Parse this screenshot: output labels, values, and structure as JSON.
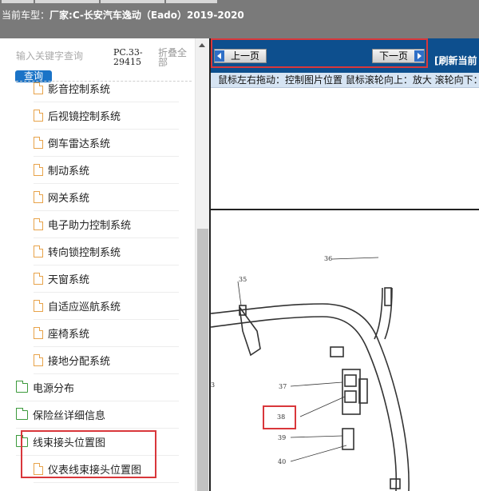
{
  "header": {
    "car_label": "当前车型：",
    "car_name": "厂家:C-长安汽车逸动（Eado）2019-2020"
  },
  "search": {
    "placeholder": "输入关键字查询",
    "button": "查询",
    "pc_code": "PC.33-29415",
    "collapse_all": "折叠全部"
  },
  "tree": [
    {
      "label": "影音控制系统",
      "icon": "file-icon",
      "level": 2
    },
    {
      "label": "后视镜控制系统",
      "icon": "file-icon",
      "level": 2
    },
    {
      "label": "倒车雷达系统",
      "icon": "file-icon",
      "level": 2
    },
    {
      "label": "制动系统",
      "icon": "file-icon",
      "level": 2
    },
    {
      "label": "网关系统",
      "icon": "file-icon",
      "level": 2
    },
    {
      "label": "电子助力控制系统",
      "icon": "file-icon",
      "level": 2
    },
    {
      "label": "转向锁控制系统",
      "icon": "file-icon",
      "level": 2
    },
    {
      "label": "天窗系统",
      "icon": "file-icon",
      "level": 2
    },
    {
      "label": "自适应巡航系统",
      "icon": "file-icon",
      "level": 2
    },
    {
      "label": "座椅系统",
      "icon": "file-icon",
      "level": 2
    },
    {
      "label": "接地分配系统",
      "icon": "file-icon",
      "level": 2
    },
    {
      "label": "电源分布",
      "icon": "folder-icon",
      "level": 1
    },
    {
      "label": "保险丝详细信息",
      "icon": "folder-icon",
      "level": 1
    },
    {
      "label": "线束接头位置图",
      "icon": "folder-open-icon",
      "level": 1
    },
    {
      "label": "仪表线束接头位置图",
      "icon": "file-icon",
      "level": 2
    }
  ],
  "viewer": {
    "prev": "上一页",
    "next": "下一页",
    "refresh": "[刷新当前",
    "hint": "鼠标左右拖动：控制图片位置  鼠标滚轮向上：放大   滚轮向下："
  },
  "diagram": {
    "callouts": [
      "36",
      "35",
      "37",
      "38",
      "39",
      "40",
      "3"
    ]
  },
  "colors": {
    "header_bg": "#7a7a7a",
    "nav_bg": "#0d4f8e",
    "hint_bg": "#d6e4f3",
    "button_blue": "#1a73c7",
    "highlight": "#d9373b"
  }
}
